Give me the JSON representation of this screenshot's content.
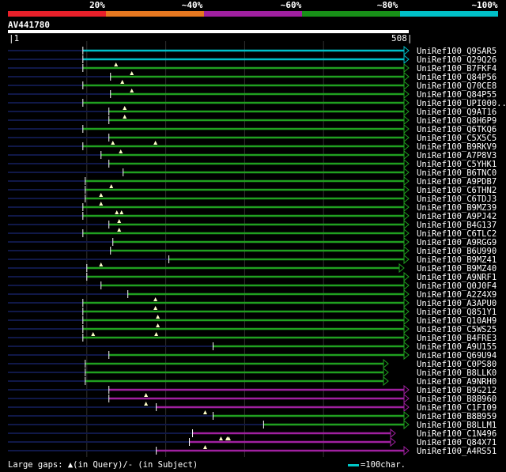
{
  "legend": {
    "labels": [
      "20%",
      "~40%",
      "~60%",
      "~80%",
      "~100%"
    ],
    "colors": [
      "#e8202a",
      "#e67820",
      "#a020a0",
      "#189018",
      "#00c0c8"
    ]
  },
  "query": {
    "name": "AV441780",
    "start_label": "1",
    "end_label": "508"
  },
  "footer": {
    "gaps_note": "Large gaps: ▲(in Query)/- (in Subject)",
    "scale_note": "=100char."
  },
  "chart_data": {
    "type": "alignment",
    "query_length": 508,
    "hits": [
      {
        "name": "UniRef100_Q9SAR5",
        "color": "cyan",
        "start": 95,
        "end": 508,
        "arrow": true,
        "gaps_query": []
      },
      {
        "name": "UniRef100_Q29Q26",
        "color": "cyan",
        "start": 95,
        "end": 508,
        "arrow": true,
        "gaps_query": []
      },
      {
        "name": "UniRef100_B7FKF4",
        "color": "green",
        "start": 95,
        "end": 508,
        "arrow": true,
        "gaps_query": [
          137
        ]
      },
      {
        "name": "UniRef100_Q84P56",
        "color": "green",
        "start": 130,
        "end": 508,
        "arrow": true,
        "gaps_query": [
          157
        ]
      },
      {
        "name": "UniRef100_Q70CE8",
        "color": "green",
        "start": 95,
        "end": 508,
        "arrow": true,
        "gaps_query": [
          145
        ]
      },
      {
        "name": "UniRef100_Q84P55",
        "color": "green",
        "start": 130,
        "end": 508,
        "arrow": true,
        "gaps_query": [
          157
        ]
      },
      {
        "name": "UniRef100_UPI000..",
        "color": "green",
        "start": 95,
        "end": 508,
        "arrow": true,
        "gaps_query": []
      },
      {
        "name": "UniRef100_Q9AT16",
        "color": "green",
        "start": 128,
        "end": 508,
        "arrow": true,
        "gaps_query": [
          148
        ]
      },
      {
        "name": "UniRef100_Q8H6P9",
        "color": "green",
        "start": 128,
        "end": 508,
        "arrow": true,
        "gaps_query": [
          148
        ]
      },
      {
        "name": "UniRef100_Q6TKQ6",
        "color": "green",
        "start": 95,
        "end": 508,
        "arrow": true,
        "gaps_query": []
      },
      {
        "name": "UniRef100_C5X5C5",
        "color": "green",
        "start": 128,
        "end": 508,
        "arrow": true,
        "gaps_query": []
      },
      {
        "name": "UniRef100_B9RKV9",
        "color": "green",
        "start": 95,
        "end": 508,
        "arrow": true,
        "gaps_query": [
          133,
          187
        ]
      },
      {
        "name": "UniRef100_A7P8V3",
        "color": "green",
        "start": 118,
        "end": 508,
        "arrow": true,
        "gaps_query": [
          143
        ]
      },
      {
        "name": "UniRef100_C5YHK1",
        "color": "green",
        "start": 128,
        "end": 508,
        "arrow": true,
        "gaps_query": []
      },
      {
        "name": "UniRef100_B6TNC0",
        "color": "green",
        "start": 146,
        "end": 508,
        "arrow": true,
        "gaps_query": []
      },
      {
        "name": "UniRef100_A9PDB7",
        "color": "green",
        "start": 98,
        "end": 508,
        "arrow": true,
        "gaps_query": []
      },
      {
        "name": "UniRef100_C6THN2",
        "color": "green",
        "start": 98,
        "end": 508,
        "arrow": true,
        "gaps_query": [
          131
        ]
      },
      {
        "name": "UniRef100_C6TDJ3",
        "color": "green",
        "start": 98,
        "end": 508,
        "arrow": true,
        "gaps_query": [
          118
        ]
      },
      {
        "name": "UniRef100_B9MZ39",
        "color": "green",
        "start": 95,
        "end": 508,
        "arrow": true,
        "gaps_query": [
          118
        ]
      },
      {
        "name": "UniRef100_A9PJ42",
        "color": "green",
        "start": 95,
        "end": 508,
        "arrow": true,
        "gaps_query": [
          138,
          144
        ]
      },
      {
        "name": "UniRef100_B4G137",
        "color": "green",
        "start": 128,
        "end": 508,
        "arrow": true,
        "gaps_query": [
          141
        ]
      },
      {
        "name": "UniRef100_C6TLC2",
        "color": "green",
        "start": 95,
        "end": 508,
        "arrow": true,
        "gaps_query": [
          141
        ]
      },
      {
        "name": "UniRef100_A9RGG9",
        "color": "green",
        "start": 133,
        "end": 508,
        "arrow": true,
        "gaps_query": []
      },
      {
        "name": "UniRef100_B6U990",
        "color": "green",
        "start": 130,
        "end": 508,
        "arrow": true,
        "gaps_query": []
      },
      {
        "name": "UniRef100_B9MZ41",
        "color": "green",
        "start": 204,
        "end": 508,
        "arrow": true,
        "gaps_query": []
      },
      {
        "name": "UniRef100_B9MZ40",
        "color": "green",
        "start": 100,
        "end": 502,
        "arrow": true,
        "gaps_query": [
          118
        ]
      },
      {
        "name": "UniRef100_A9NRF1",
        "color": "green",
        "start": 100,
        "end": 508,
        "arrow": true,
        "gaps_query": []
      },
      {
        "name": "UniRef100_Q0J0F4",
        "color": "green",
        "start": 118,
        "end": 508,
        "arrow": true,
        "gaps_query": []
      },
      {
        "name": "UniRef100_A2Z4X9",
        "color": "green",
        "start": 152,
        "end": 508,
        "arrow": true,
        "gaps_query": []
      },
      {
        "name": "UniRef100_A3APU0",
        "color": "green",
        "start": 95,
        "end": 508,
        "arrow": true,
        "gaps_query": [
          187
        ]
      },
      {
        "name": "UniRef100_Q851Y1",
        "color": "green",
        "start": 95,
        "end": 508,
        "arrow": true,
        "gaps_query": [
          187
        ]
      },
      {
        "name": "UniRef100_Q10AH9",
        "color": "green",
        "start": 95,
        "end": 508,
        "arrow": true,
        "gaps_query": [
          190
        ]
      },
      {
        "name": "UniRef100_C5WS25",
        "color": "green",
        "start": 95,
        "end": 508,
        "arrow": true,
        "gaps_query": [
          190
        ]
      },
      {
        "name": "UniRef100_B4FRE3",
        "color": "green",
        "start": 95,
        "end": 508,
        "arrow": true,
        "gaps_query": [
          108,
          188
        ]
      },
      {
        "name": "UniRef100_A9U155",
        "color": "green",
        "start": 260,
        "end": 508,
        "arrow": true,
        "gaps_query": []
      },
      {
        "name": "UniRef100_Q69U94",
        "color": "green",
        "start": 128,
        "end": 508,
        "arrow": true,
        "gaps_query": []
      },
      {
        "name": "UniRef100_C0PS80",
        "color": "green",
        "start": 98,
        "end": 482,
        "arrow": true,
        "gaps_query": []
      },
      {
        "name": "UniRef100_B8LLK0",
        "color": "green",
        "start": 98,
        "end": 482,
        "arrow": true,
        "gaps_query": []
      },
      {
        "name": "UniRef100_A9NRH0",
        "color": "green",
        "start": 98,
        "end": 482,
        "arrow": true,
        "gaps_query": []
      },
      {
        "name": "UniRef100_B9G212",
        "color": "purple",
        "start": 128,
        "end": 508,
        "arrow": true,
        "gaps_query": []
      },
      {
        "name": "UniRef100_B8B960",
        "color": "purple",
        "start": 128,
        "end": 508,
        "arrow": true,
        "gaps_query": [
          175
        ]
      },
      {
        "name": "UniRef100_C1FI09",
        "color": "purple",
        "start": 188,
        "end": 508,
        "arrow": true,
        "gaps_query": [
          175
        ]
      },
      {
        "name": "UniRef100_B8B959",
        "color": "green",
        "start": 260,
        "end": 508,
        "arrow": true,
        "gaps_query": [
          250
        ]
      },
      {
        "name": "UniRef100_B8LLM1",
        "color": "green",
        "start": 324,
        "end": 508,
        "arrow": true,
        "gaps_query": []
      },
      {
        "name": "UniRef100_C1N496",
        "color": "purple",
        "start": 234,
        "end": 491,
        "arrow": true,
        "gaps_query": []
      },
      {
        "name": "UniRef100_Q84X71",
        "color": "purple",
        "start": 230,
        "end": 491,
        "arrow": true,
        "gaps_query": [
          280,
          270,
          278
        ]
      },
      {
        "name": "UniRef100_A4RS51",
        "color": "purple",
        "start": 188,
        "end": 508,
        "arrow": true,
        "gaps_query": [
          250
        ]
      }
    ]
  }
}
